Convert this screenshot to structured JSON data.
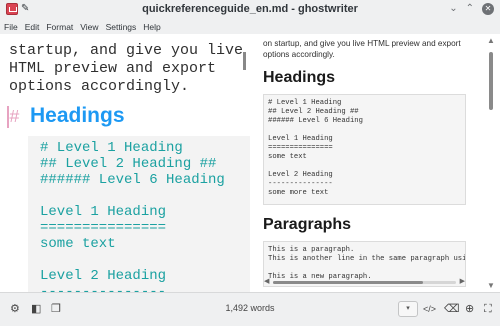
{
  "window": {
    "title": "quickreferenceguide_en.md - ghostwriter",
    "controls": {
      "minimize": "⌄",
      "maximize": "⌃",
      "close": "✕"
    }
  },
  "menu": [
    "File",
    "Edit",
    "Format",
    "View",
    "Settings",
    "Help"
  ],
  "editor": {
    "lines_top": [
      "startup, and give you live",
      "HTML preview and export",
      "options accordingly."
    ],
    "heading_mark": "#",
    "heading": "Headings",
    "code_lines": [
      "# Level 1 Heading",
      "## Level 2 Heading ##",
      "###### Level 6 Heading",
      "",
      "Level 1 Heading",
      "===============",
      "some text",
      "",
      "Level 2 Heading",
      "---------------"
    ]
  },
  "preview": {
    "intro_lines": [
      "on startup, and give you live HTML preview and export",
      "options accordingly."
    ],
    "headings_title": "Headings",
    "headings_code": [
      "# Level 1 Heading",
      "## Level 2 Heading ##",
      "###### Level 6 Heading",
      "",
      "Level 1 Heading",
      "===============",
      "some text",
      "",
      "Level 2 Heading",
      "---------------",
      "some more text"
    ],
    "paragraphs_title": "Paragraphs",
    "paragraphs_code": [
      "This is a paragraph.",
      "This is another line in the same paragraph using",
      "",
      "This is a new paragraph."
    ]
  },
  "statusbar": {
    "word_count": "1,492 words",
    "icons": [
      "gear-icon",
      "sidebar-icon",
      "copy-icon",
      "preview-style-select",
      "code-view-icon",
      "backspace-icon",
      "target-icon",
      "fullscreen-icon"
    ]
  }
}
